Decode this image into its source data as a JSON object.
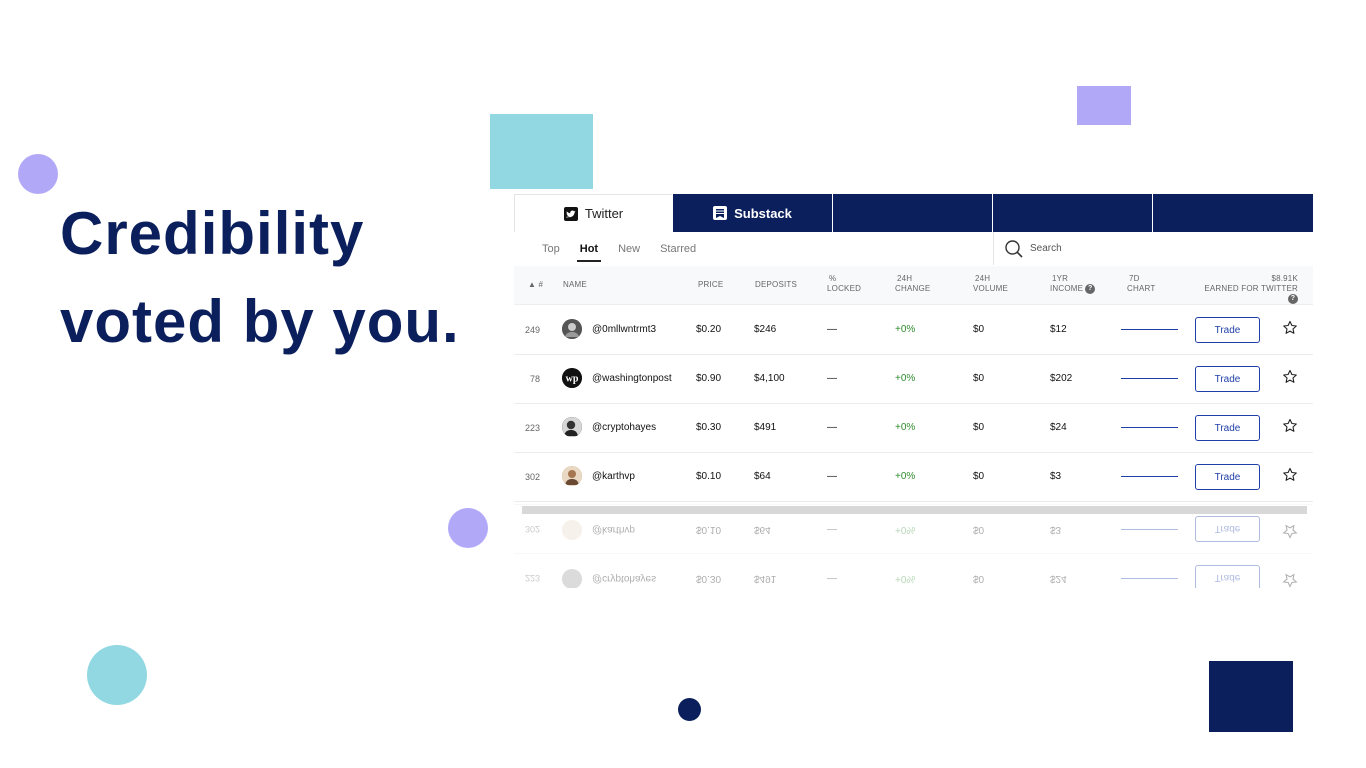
{
  "headline": {
    "line1": "Credibility",
    "line2": "voted by you."
  },
  "colors": {
    "navy": "#0b1f5c",
    "lavender": "#b1a9f8",
    "teal": "#92d8e3",
    "accent_blue": "#1f3fa8",
    "positive": "#2e8b2e"
  },
  "tabs": [
    {
      "label": "Twitter",
      "icon": "twitter-icon",
      "active": true
    },
    {
      "label": "Substack",
      "icon": "substack-icon",
      "active": false
    },
    {
      "label": "",
      "active": false
    },
    {
      "label": "",
      "active": false
    },
    {
      "label": "",
      "active": false
    }
  ],
  "filters": [
    "Top",
    "Hot",
    "New",
    "Starred"
  ],
  "active_filter": "Hot",
  "search": {
    "placeholder": "Search",
    "icon": "search-icon"
  },
  "columns": {
    "rank": "▲ #",
    "name": "NAME",
    "price": "PRICE",
    "deposits": "DEPOSITS",
    "locked": [
      "%",
      "LOCKED"
    ],
    "change": [
      "24H",
      "CHANGE"
    ],
    "volume": [
      "24H",
      "VOLUME"
    ],
    "income": [
      "1YR",
      "INCOME"
    ],
    "chart": [
      "7D",
      "CHART"
    ],
    "earned_total": "$8.91K",
    "earned": "EARNED FOR TWITTER"
  },
  "rows": [
    {
      "rank": "249",
      "name": "@0mllwntrmt3",
      "price": "$0.20",
      "deposits": "$246",
      "locked": "—",
      "change": "+0%",
      "volume": "$0",
      "income": "$12",
      "trade": "Trade"
    },
    {
      "rank": "78",
      "name": "@washingtonpost",
      "price": "$0.90",
      "deposits": "$4,100",
      "locked": "—",
      "change": "+0%",
      "volume": "$0",
      "income": "$202",
      "trade": "Trade"
    },
    {
      "rank": "223",
      "name": "@cryptohayes",
      "price": "$0.30",
      "deposits": "$491",
      "locked": "—",
      "change": "+0%",
      "volume": "$0",
      "income": "$24",
      "trade": "Trade"
    },
    {
      "rank": "302",
      "name": "@karthvp",
      "price": "$0.10",
      "deposits": "$64",
      "locked": "—",
      "change": "+0%",
      "volume": "$0",
      "income": "$3",
      "trade": "Trade"
    }
  ],
  "reflection_rows": [
    {
      "rank": "302",
      "name": "@karthvp",
      "price": "$0.10",
      "deposits": "$64",
      "locked": "—",
      "change": "+0%",
      "volume": "$0",
      "income": "$3",
      "trade": "Trade"
    },
    {
      "rank": "223",
      "name": "@cryptohayes",
      "price": "$0.30",
      "deposits": "$491",
      "locked": "—",
      "change": "+0%",
      "volume": "$0",
      "income": "$24",
      "trade": "Trade"
    }
  ]
}
